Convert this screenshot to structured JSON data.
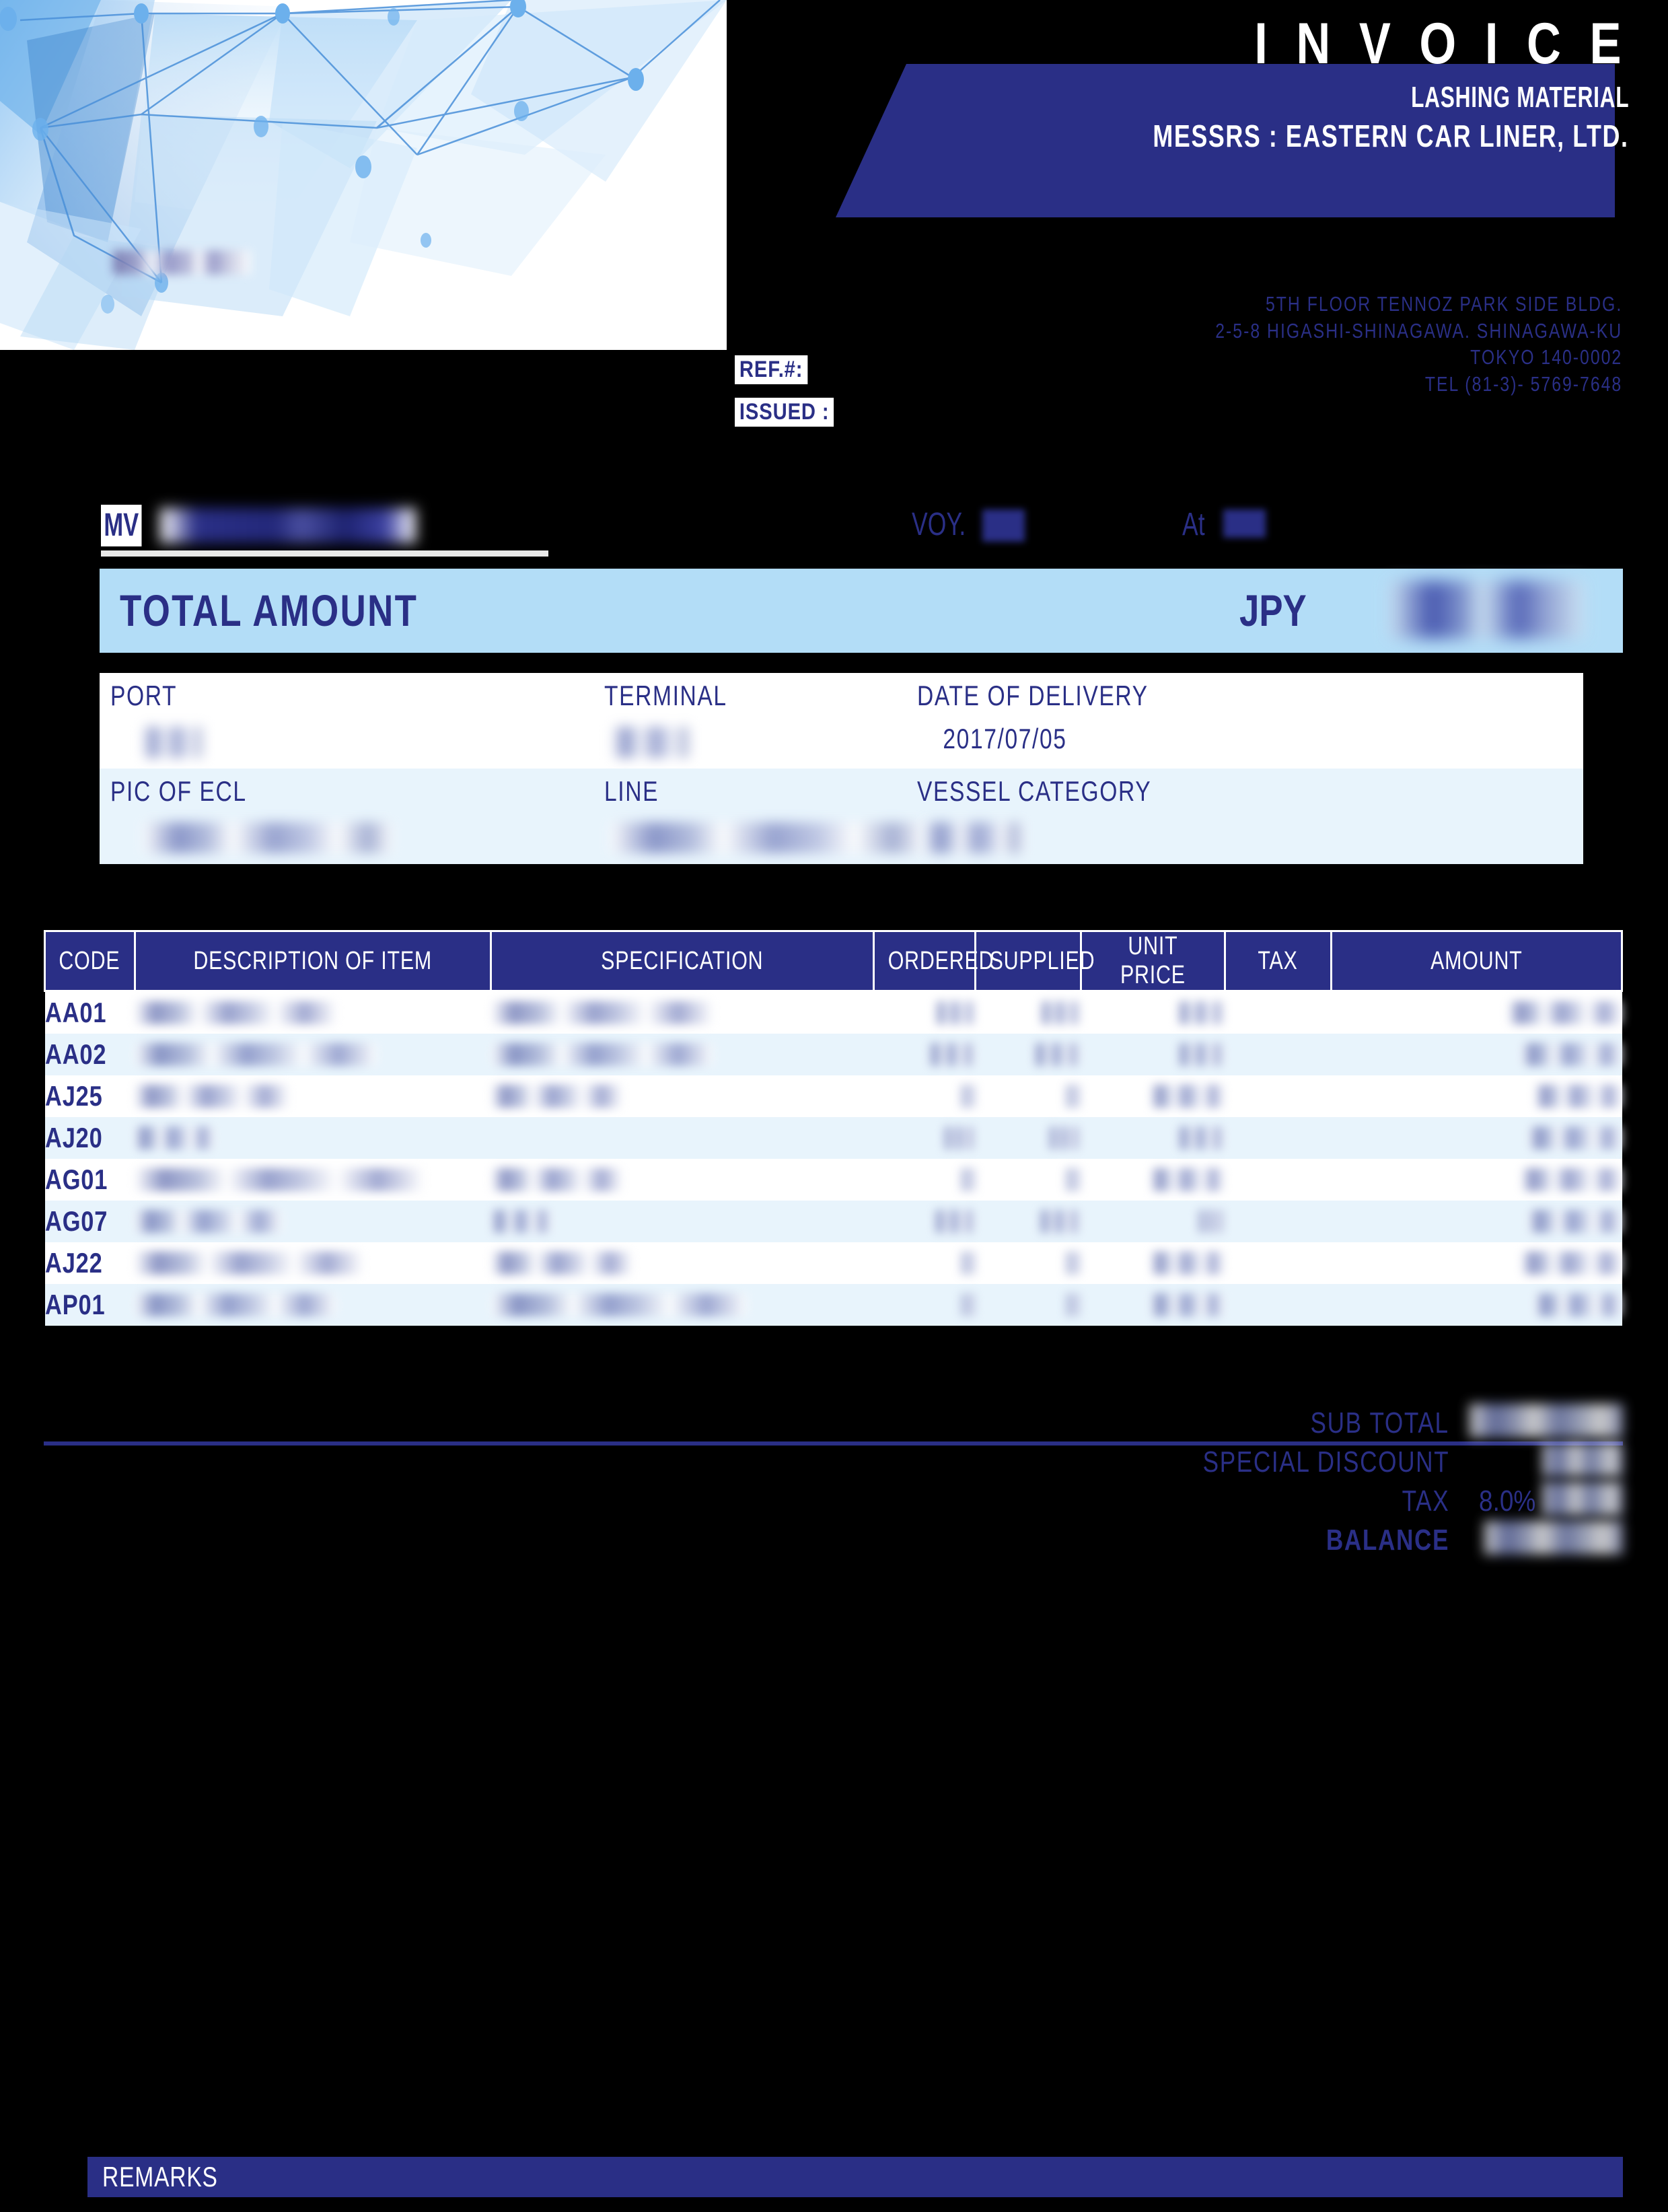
{
  "header": {
    "title": "I N V O I C E",
    "subtitle": "LASHING MATERIAL",
    "messrs": "MESSRS : EASTERN CAR LINER, LTD.",
    "address": [
      "5TH FLOOR TENNOZ PARK SIDE BLDG.",
      "2-5-8 HIGASHI-SHINAGAWA.  SHINAGAWA-KU",
      "TOKYO 140-0002",
      "TEL (81-3)- 5769-7648"
    ],
    "ref_label": "REF.#:",
    "issued_label": "ISSUED :",
    "ref_value": "",
    "issued_value": ""
  },
  "vessel": {
    "mv_label": "MV",
    "mv_value": "",
    "voy_label": "VOY.",
    "voy_value": "",
    "at_label": "At",
    "at_value": ""
  },
  "total_banner": {
    "label": "TOTAL AMOUNT",
    "currency": "JPY",
    "amount": ""
  },
  "info": {
    "port_label": "PORT",
    "port_value": "",
    "terminal_label": "TERMINAL",
    "terminal_value": "",
    "date_of_delivery_label": "DATE OF DELIVERY",
    "date_of_delivery_value": "2017/07/05",
    "pic_label": "PIC OF ECL",
    "pic_value": "",
    "line_label": "LINE",
    "line_value": "",
    "vessel_category_label": "VESSEL CATEGORY",
    "vessel_category_value": ""
  },
  "table": {
    "columns": [
      "CODE",
      "DESCRIPTION OF ITEM",
      "SPECIFICATION",
      "ORDERED",
      "SUPPLIED",
      "UNIT PRICE",
      "TAX",
      "AMOUNT"
    ],
    "rows": [
      {
        "code": "AA01",
        "description": "",
        "specification": "",
        "ordered": "",
        "supplied": "",
        "unit_price": "",
        "tax": "",
        "amount": ""
      },
      {
        "code": "AA02",
        "description": "",
        "specification": "",
        "ordered": "",
        "supplied": "",
        "unit_price": "",
        "tax": "",
        "amount": ""
      },
      {
        "code": "AJ25",
        "description": "",
        "specification": "",
        "ordered": "",
        "supplied": "",
        "unit_price": "",
        "tax": "",
        "amount": ""
      },
      {
        "code": "AJ20",
        "description": "",
        "specification": "",
        "ordered": "",
        "supplied": "",
        "unit_price": "",
        "tax": "",
        "amount": ""
      },
      {
        "code": "AG01",
        "description": "",
        "specification": "",
        "ordered": "",
        "supplied": "",
        "unit_price": "",
        "tax": "",
        "amount": ""
      },
      {
        "code": "AG07",
        "description": "",
        "specification": "",
        "ordered": "",
        "supplied": "",
        "unit_price": "",
        "tax": "",
        "amount": ""
      },
      {
        "code": "AJ22",
        "description": "",
        "specification": "",
        "ordered": "",
        "supplied": "",
        "unit_price": "",
        "tax": "",
        "amount": ""
      },
      {
        "code": "AP01",
        "description": "",
        "specification": "",
        "ordered": "",
        "supplied": "",
        "unit_price": "",
        "tax": "",
        "amount": ""
      }
    ]
  },
  "totals": {
    "sub_total_label": "SUB TOTAL",
    "sub_total_value": "",
    "special_discount_label": "SPECIAL DISCOUNT",
    "special_discount_value": "",
    "tax_label": "TAX",
    "tax_rate": "8.0%",
    "tax_value": "",
    "balance_label": "BALANCE",
    "balance_value": ""
  },
  "remarks": {
    "label": "REMARKS",
    "text": ""
  },
  "colors": {
    "brand_navy": "#2a2f86",
    "banner_light_blue": "#b3ddf7",
    "row_tint": "#e8f4fc",
    "page_white": "#ffffff",
    "background": "#000000"
  }
}
